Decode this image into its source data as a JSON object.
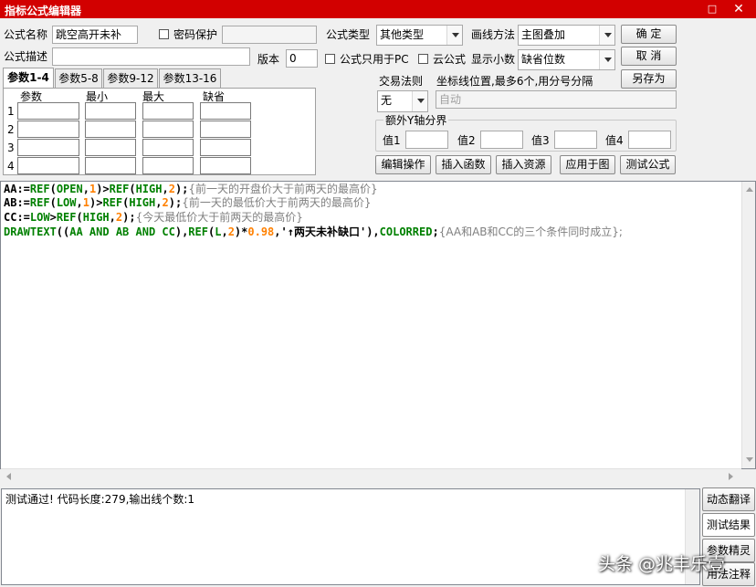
{
  "window": {
    "title": "指标公式编辑器",
    "restore_glyph": "□",
    "close_glyph": "✕"
  },
  "form": {
    "name_label": "公式名称",
    "name_value": "跳空高开未补",
    "password_label": "密码保护",
    "password_value": "",
    "type_label": "公式类型",
    "type_value": "其他类型",
    "draw_method_label": "画线方法",
    "draw_method_value": "主图叠加",
    "desc_label": "公式描述",
    "desc_value": "",
    "version_label": "版本",
    "version_value": "0",
    "pc_only_label": "公式只用于PC",
    "cloud_label": "云公式",
    "decimals_label": "显示小数",
    "decimals_value": "缺省位数"
  },
  "buttons": {
    "ok": "确  定",
    "cancel": "取  消",
    "save_as": "另存为"
  },
  "tabs": [
    "参数1-4",
    "参数5-8",
    "参数9-12",
    "参数13-16"
  ],
  "param_table": {
    "headers": [
      "参数",
      "最小",
      "最大",
      "缺省"
    ],
    "rows": [
      "1",
      "2",
      "3",
      "4"
    ]
  },
  "trade_rule": {
    "label": "交易法则",
    "value": "无"
  },
  "coord": {
    "label": "坐标线位置,最多6个,用分号分隔",
    "value": "自动"
  },
  "extra_y": {
    "title": "额外Y轴分界",
    "labels": [
      "值1",
      "值2",
      "值3",
      "值4"
    ]
  },
  "actions": [
    "编辑操作",
    "插入函数",
    "插入资源",
    "应用于图",
    "测试公式"
  ],
  "code": [
    [
      [
        "var",
        "AA:="
      ],
      [
        "kw",
        "REF"
      ],
      [
        "op",
        "("
      ],
      [
        "kw",
        "OPEN"
      ],
      [
        "op",
        ","
      ],
      [
        "num",
        "1"
      ],
      [
        "op",
        ")>"
      ],
      [
        "kw",
        "REF"
      ],
      [
        "op",
        "("
      ],
      [
        "kw",
        "HIGH"
      ],
      [
        "op",
        ","
      ],
      [
        "num",
        "2"
      ],
      [
        "op",
        ");"
      ],
      [
        "cmt",
        "{前一天的开盘价大于前两天的最高价}"
      ]
    ],
    [
      [
        "var",
        "AB:="
      ],
      [
        "kw",
        "REF"
      ],
      [
        "op",
        "("
      ],
      [
        "kw",
        "LOW"
      ],
      [
        "op",
        ","
      ],
      [
        "num",
        "1"
      ],
      [
        "op",
        ")>"
      ],
      [
        "kw",
        "REF"
      ],
      [
        "op",
        "("
      ],
      [
        "kw",
        "HIGH"
      ],
      [
        "op",
        ","
      ],
      [
        "num",
        "2"
      ],
      [
        "op",
        ");"
      ],
      [
        "cmt",
        "{前一天的最低价大于前两天的最高价}"
      ]
    ],
    [
      [
        "var",
        "CC:="
      ],
      [
        "kw",
        "LOW"
      ],
      [
        "op",
        ">"
      ],
      [
        "kw",
        "REF"
      ],
      [
        "op",
        "("
      ],
      [
        "kw",
        "HIGH"
      ],
      [
        "op",
        ","
      ],
      [
        "num",
        "2"
      ],
      [
        "op",
        ");"
      ],
      [
        "cmt",
        "{今天最低价大于前两天的最高价}"
      ]
    ],
    [
      [
        "kw",
        "DRAWTEXT"
      ],
      [
        "op",
        "(("
      ],
      [
        "kw",
        "AA AND AB AND CC"
      ],
      [
        "op",
        "),"
      ],
      [
        "kw",
        "REF"
      ],
      [
        "op",
        "("
      ],
      [
        "kw",
        "L"
      ],
      [
        "op",
        ","
      ],
      [
        "num",
        "2"
      ],
      [
        "op",
        ")*"
      ],
      [
        "num",
        "0.98"
      ],
      [
        "op",
        ",'"
      ],
      [
        "str",
        "↑两天未补缺口"
      ],
      [
        "op",
        "'),"
      ],
      [
        "kw",
        "COLORRED"
      ],
      [
        "op",
        ";"
      ],
      [
        "cmt",
        "{AA和AB和CC的三个条件同时成立};"
      ]
    ]
  ],
  "result_text": "测试通过! 代码长度:279,输出线个数:1",
  "side_buttons": [
    "动态翻译",
    "测试结果",
    "参数精灵",
    "用法注释"
  ],
  "watermark": "头条 @兆丰乐壹"
}
